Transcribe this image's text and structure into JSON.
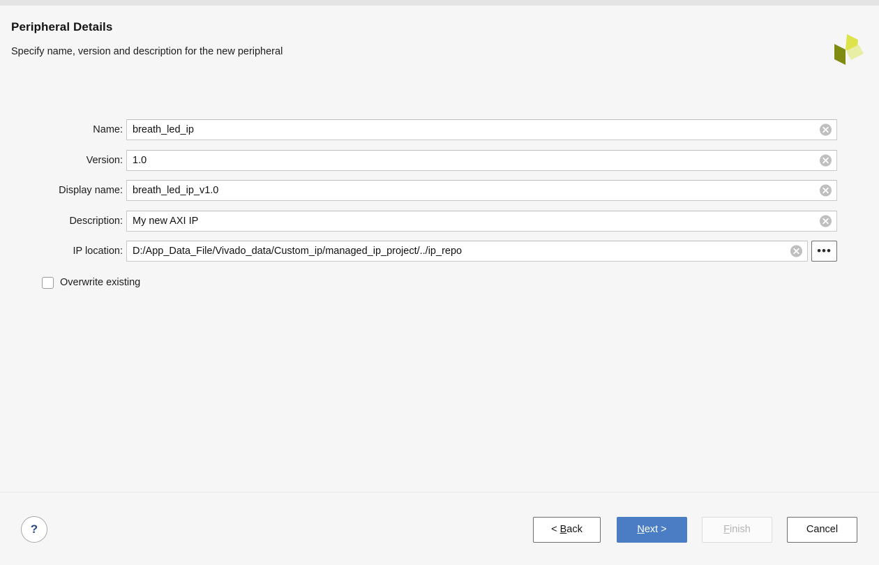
{
  "header": {
    "title": "Peripheral Details",
    "subtitle": "Specify name, version and description for the new peripheral",
    "logo_colors": {
      "dark": "#7f8c11",
      "bright": "#dde34a",
      "pale": "#e9eea6"
    }
  },
  "form": {
    "fields": [
      {
        "label": "Name:",
        "value": "breath_led_ip"
      },
      {
        "label": "Version:",
        "value": "1.0"
      },
      {
        "label": "Display name:",
        "value": "breath_led_ip_v1.0"
      },
      {
        "label": "Description:",
        "value": "My new AXI IP"
      },
      {
        "label": "IP location:",
        "value": "D:/App_Data_File/Vivado_data/Custom_ip/managed_ip_project/../ip_repo"
      }
    ],
    "clear_icon": "clear-circle-x-icon",
    "browse_button": {
      "label": "•••",
      "icon": "ellipsis-icon"
    },
    "checkbox": {
      "label": "Overwrite existing",
      "checked": false
    }
  },
  "footer": {
    "help": {
      "label": "?",
      "icon": "question-mark-icon"
    },
    "buttons": [
      {
        "name": "back",
        "prefix": "< ",
        "accel": "B",
        "rest": "ack",
        "suffix": "",
        "enabled": true
      },
      {
        "name": "next",
        "prefix": "",
        "accel": "N",
        "rest": "ext",
        "suffix": " >",
        "enabled": true
      },
      {
        "name": "finish",
        "prefix": "",
        "accel": "F",
        "rest": "inish",
        "suffix": "",
        "enabled": false
      },
      {
        "name": "cancel",
        "prefix": "",
        "accel": "",
        "rest": "Cancel",
        "suffix": "",
        "enabled": true
      }
    ],
    "accent_color": "#4a7dc4"
  }
}
